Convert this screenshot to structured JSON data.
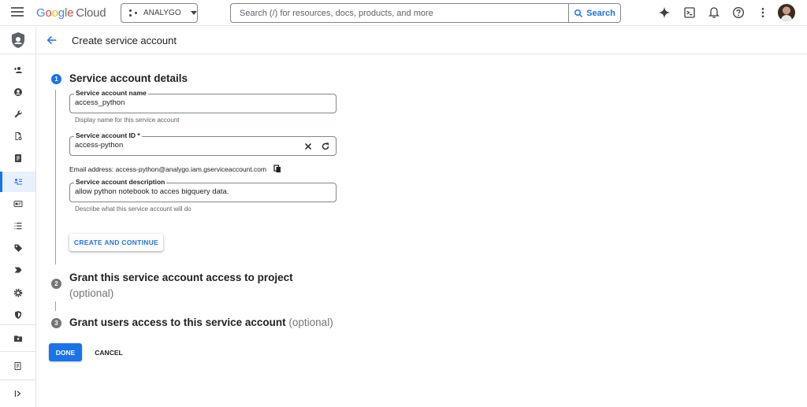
{
  "topbar": {
    "logo_parts": [
      "G",
      "o",
      "o",
      "g",
      "l",
      "e"
    ],
    "logo_suffix": "Cloud",
    "project_name": "ANALYGO",
    "search_placeholder": "Search (/) for resources, docs, products, and more",
    "search_button": "Search"
  },
  "header": {
    "title": "Create service account"
  },
  "steps": [
    {
      "number": "1",
      "title": "Service account details",
      "optional": ""
    },
    {
      "number": "2",
      "title": "Grant this service account access to project",
      "optional": "(optional)"
    },
    {
      "number": "3",
      "title": "Grant users access to this service account",
      "optional": "(optional)"
    }
  ],
  "form": {
    "name_label": "Service account name",
    "name_value": "access_python",
    "name_hint": "Display name for this service account",
    "id_label": "Service account ID *",
    "id_value": "access-python",
    "email_text": "Email address: access-python@analygo.iam.gserviceaccount.com",
    "desc_label": "Service account description",
    "desc_value": "allow python notebook to acces bigquery data.",
    "desc_hint": "Describe what this service account will do",
    "create_button": "CREATE AND CONTINUE"
  },
  "actions": {
    "done": "DONE",
    "cancel": "CANCEL"
  },
  "colors": {
    "accent": "#1a73e8",
    "active_rail_bg": "#e8f0fe",
    "step_inactive": "#757575"
  }
}
